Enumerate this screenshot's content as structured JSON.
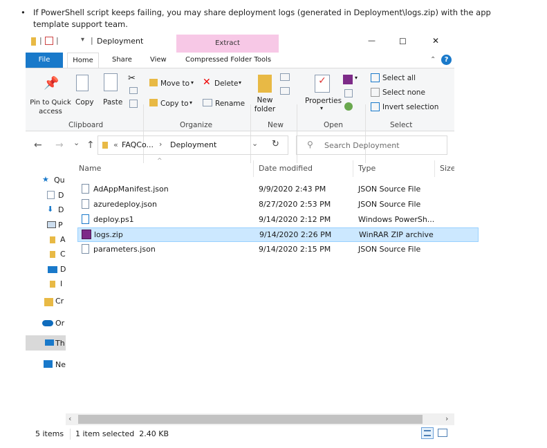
{
  "note": {
    "bullet": "•",
    "line1": "If PowerShell script keeps failing, you may share deployment logs (generated in Deployment\\logs.zip) with the app",
    "line2": "template support team."
  },
  "titlebar": {
    "title": "Deployment",
    "separator": "|",
    "qat_dropdown": "▾",
    "contextual_tab": "Extract",
    "minimize": "—",
    "maximize": "☐",
    "close": "✕"
  },
  "ribbon_tabs": [
    "File",
    "Home",
    "Share",
    "View",
    "Compressed Folder Tools"
  ],
  "ribbon": {
    "pin": "Pin to Quick access",
    "pin_l1": "Pin to Quick",
    "pin_l2": "access",
    "copy": "Copy",
    "paste": "Paste",
    "clipboard": "Clipboard",
    "move_to": "Move to",
    "copy_to": "Copy to",
    "delete": "Delete",
    "rename": "Rename",
    "organize": "Organize",
    "new_folder_l1": "New",
    "new_folder_l2": "folder",
    "new": "New",
    "properties": "Properties",
    "open": "Open",
    "select_all": "Select all",
    "select_none": "Select none",
    "invert_selection": "Invert selection",
    "select": "Select"
  },
  "address": {
    "back": "←",
    "forward": "→",
    "recent": "⌄",
    "up": "↑",
    "overflow": "«",
    "crumb1": "FAQCo...",
    "chevron": "›",
    "crumb2": "Deployment",
    "dropdown": "⌄",
    "refresh": "↻",
    "search_placeholder": "Search Deployment"
  },
  "columns": {
    "name": "Name",
    "date": "Date modified",
    "type": "Type",
    "size": "Size"
  },
  "files": [
    {
      "name": "AdAppManifest.json",
      "date": "9/9/2020 2:43 PM",
      "type": "JSON Source File"
    },
    {
      "name": "azuredeploy.json",
      "date": "8/27/2020 2:53 PM",
      "type": "JSON Source File"
    },
    {
      "name": "deploy.ps1",
      "date": "9/14/2020 2:12 PM",
      "type": "Windows PowerSh..."
    },
    {
      "name": "logs.zip",
      "date": "9/14/2020 2:26 PM",
      "type": "WinRAR ZIP archive"
    },
    {
      "name": "parameters.json",
      "date": "9/14/2020 2:15 PM",
      "type": "JSON Source File"
    }
  ],
  "nav": [
    {
      "label": "Qu"
    },
    {
      "label": "D"
    },
    {
      "label": "D"
    },
    {
      "label": "P"
    },
    {
      "label": "A"
    },
    {
      "label": "C"
    },
    {
      "label": "D"
    },
    {
      "label": "I"
    },
    {
      "label": "Cr"
    },
    {
      "label": "Or"
    },
    {
      "label": "Th"
    },
    {
      "label": "Ne"
    }
  ],
  "status": {
    "items": "5 items",
    "selected": "1 item selected  2.40 KB"
  },
  "colors": {
    "accent": "#1979ca",
    "extract_tab": "#f7c8e6",
    "selection": "#cce8ff"
  }
}
